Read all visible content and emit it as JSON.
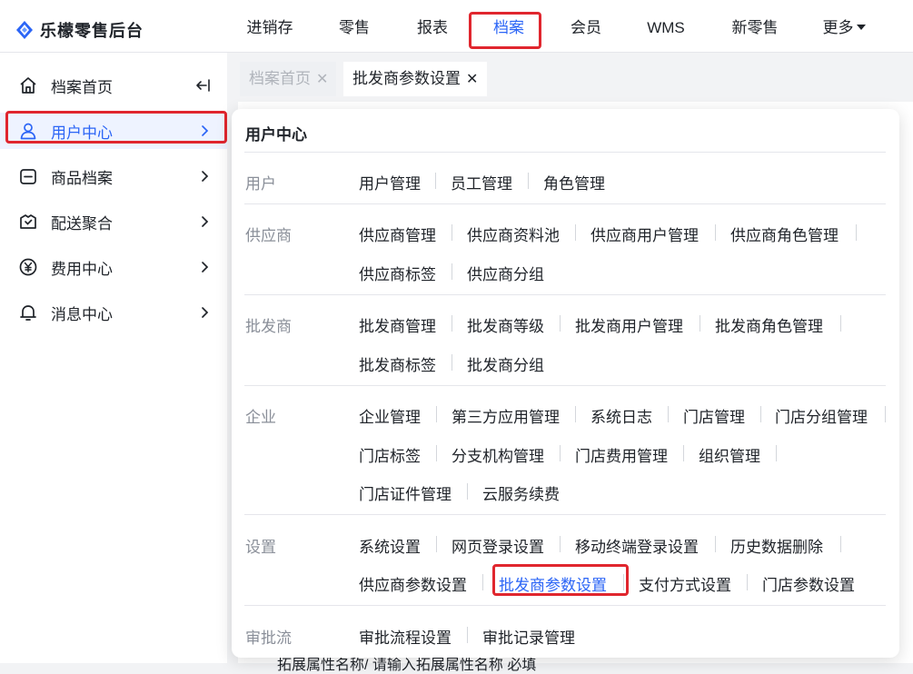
{
  "app": {
    "title": "乐檬零售后台"
  },
  "nav": {
    "items": [
      "进销存",
      "零售",
      "报表",
      "档案",
      "会员",
      "WMS",
      "新零售",
      "更多"
    ],
    "active": "档案"
  },
  "sidebar": {
    "items": [
      {
        "label": "档案首页",
        "icon": "home-icon"
      },
      {
        "label": "用户中心",
        "icon": "user-icon"
      },
      {
        "label": "商品档案",
        "icon": "box-icon"
      },
      {
        "label": "配送聚合",
        "icon": "delivery-icon"
      },
      {
        "label": "费用中心",
        "icon": "yuan-icon"
      },
      {
        "label": "消息中心",
        "icon": "bell-icon"
      }
    ],
    "active": "用户中心"
  },
  "tabs": [
    {
      "label": "档案首页",
      "active": false
    },
    {
      "label": "批发商参数设置",
      "active": true
    }
  ],
  "dropdown": {
    "title": "用户中心",
    "groups": [
      {
        "label": "用户",
        "rows": [
          [
            "用户管理",
            "员工管理",
            "角色管理"
          ]
        ]
      },
      {
        "label": "供应商",
        "rows": [
          [
            "供应商管理",
            "供应商资料池",
            "供应商用户管理",
            "供应商角色管理"
          ],
          [
            "供应商标签",
            "供应商分组"
          ]
        ]
      },
      {
        "label": "批发商",
        "rows": [
          [
            "批发商管理",
            "批发商等级",
            "批发商用户管理",
            "批发商角色管理"
          ],
          [
            "批发商标签",
            "批发商分组"
          ]
        ]
      },
      {
        "label": "企业",
        "rows": [
          [
            "企业管理",
            "第三方应用管理",
            "系统日志",
            "门店管理",
            "门店分组管理"
          ],
          [
            "门店标签",
            "分支机构管理",
            "门店费用管理",
            "组织管理"
          ],
          [
            "门店证件管理",
            "云服务续费"
          ]
        ]
      },
      {
        "label": "设置",
        "rows": [
          [
            "系统设置",
            "网页登录设置",
            "移动终端登录设置",
            "历史数据删除"
          ],
          [
            "供应商参数设置",
            "批发商参数设置",
            "支付方式设置",
            "门店参数设置"
          ]
        ]
      },
      {
        "label": "审批流",
        "rows": [
          [
            "审批流程设置",
            "审批记录管理"
          ]
        ]
      }
    ],
    "highlighted": "批发商参数设置"
  },
  "background": {
    "bottom_text": "拓展属性名称/    请输入拓展属性名称    必填"
  },
  "colors": {
    "accent": "#2b65f6",
    "highlight_box": "#e0262e"
  }
}
